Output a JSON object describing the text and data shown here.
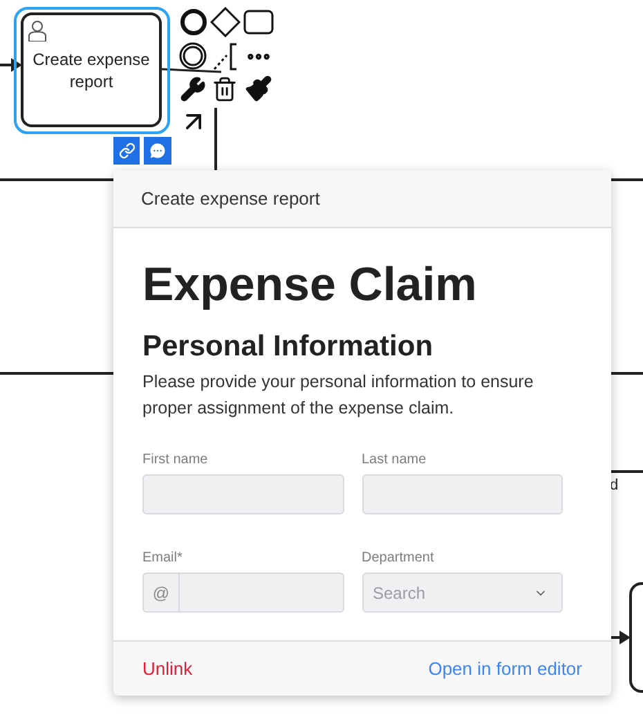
{
  "task": {
    "name": "Create expense report",
    "selected": true
  },
  "canvas_labels": [
    "d"
  ],
  "form_popup": {
    "title": "Create expense report",
    "heading": "Expense Claim",
    "section": "Personal Information",
    "description": "Please provide your personal information to ensure proper assignment of the expense claim.",
    "fields": [
      {
        "kind": "text",
        "label": "First name"
      },
      {
        "kind": "text",
        "label": "Last name"
      },
      {
        "kind": "email",
        "label": "Email*",
        "prefix": "@"
      },
      {
        "kind": "select",
        "label": "Department",
        "placeholder": "Search"
      }
    ],
    "actions": {
      "unlink": "Unlink",
      "open": "Open in form editor"
    }
  }
}
